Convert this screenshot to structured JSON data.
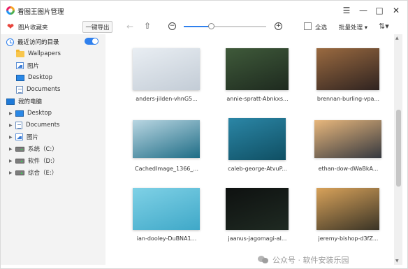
{
  "window": {
    "title": "看图王图片管理",
    "controls": [
      "menu-icon",
      "minimize-icon",
      "maximize-icon",
      "close-icon"
    ]
  },
  "toolbar": {
    "favorites_label": "图片收藏夹",
    "export_label": "一键导出",
    "zoom_level": 0.33,
    "select_all_label": "全选",
    "batch_label": "批量处理 ▾",
    "sort_icon": "sort-icon"
  },
  "sidebar": {
    "recent_label": "最近访问的目录",
    "recent_toggle_on": true,
    "recent_items": [
      {
        "label": "Wallpapers",
        "icon": "folder-icon"
      },
      {
        "label": "图片",
        "icon": "pictures-icon"
      },
      {
        "label": "Desktop",
        "icon": "desktop-icon"
      },
      {
        "label": "Documents",
        "icon": "documents-icon"
      }
    ],
    "pc_label": "我的电脑",
    "pc_items": [
      {
        "label": "Desktop",
        "icon": "desktop-icon"
      },
      {
        "label": "Documents",
        "icon": "documents-icon"
      },
      {
        "label": "图片",
        "icon": "pictures-icon"
      },
      {
        "label": "系统（C:）",
        "icon": "drive-icon"
      },
      {
        "label": "软件（D:）",
        "icon": "drive-icon"
      },
      {
        "label": "综合（E:）",
        "icon": "drive-icon"
      }
    ]
  },
  "images": [
    {
      "name": "anders-jilden-vhnG5...",
      "colors": [
        "#e9eef3",
        "#c3ccd6"
      ]
    },
    {
      "name": "annie-spratt-Abnkxs...",
      "colors": [
        "#3f5a3a",
        "#1e2a1f"
      ]
    },
    {
      "name": "brennan-burling-vpa...",
      "colors": [
        "#9a6a40",
        "#2f2320"
      ]
    },
    {
      "name": "CachedImage_1366_...",
      "colors": [
        "#b9d6e2",
        "#1f6d86"
      ]
    },
    {
      "name": "caleb-george-AtvuP...",
      "colors": [
        "#2b86a6",
        "#0f4f63"
      ]
    },
    {
      "name": "ethan-dow-dWaBkA...",
      "colors": [
        "#e8b77c",
        "#35383f"
      ]
    },
    {
      "name": "ian-dooley-DuBNA1...",
      "colors": [
        "#7fd1e6",
        "#3fa8c8"
      ]
    },
    {
      "name": "jaanus-jagomagi-al...",
      "colors": [
        "#0e1110",
        "#1f2a22"
      ]
    },
    {
      "name": "jeremy-bishop-d3fZ...",
      "colors": [
        "#d8a25a",
        "#3a3426"
      ]
    }
  ],
  "watermark": "公众号 · 软件安装乐园"
}
